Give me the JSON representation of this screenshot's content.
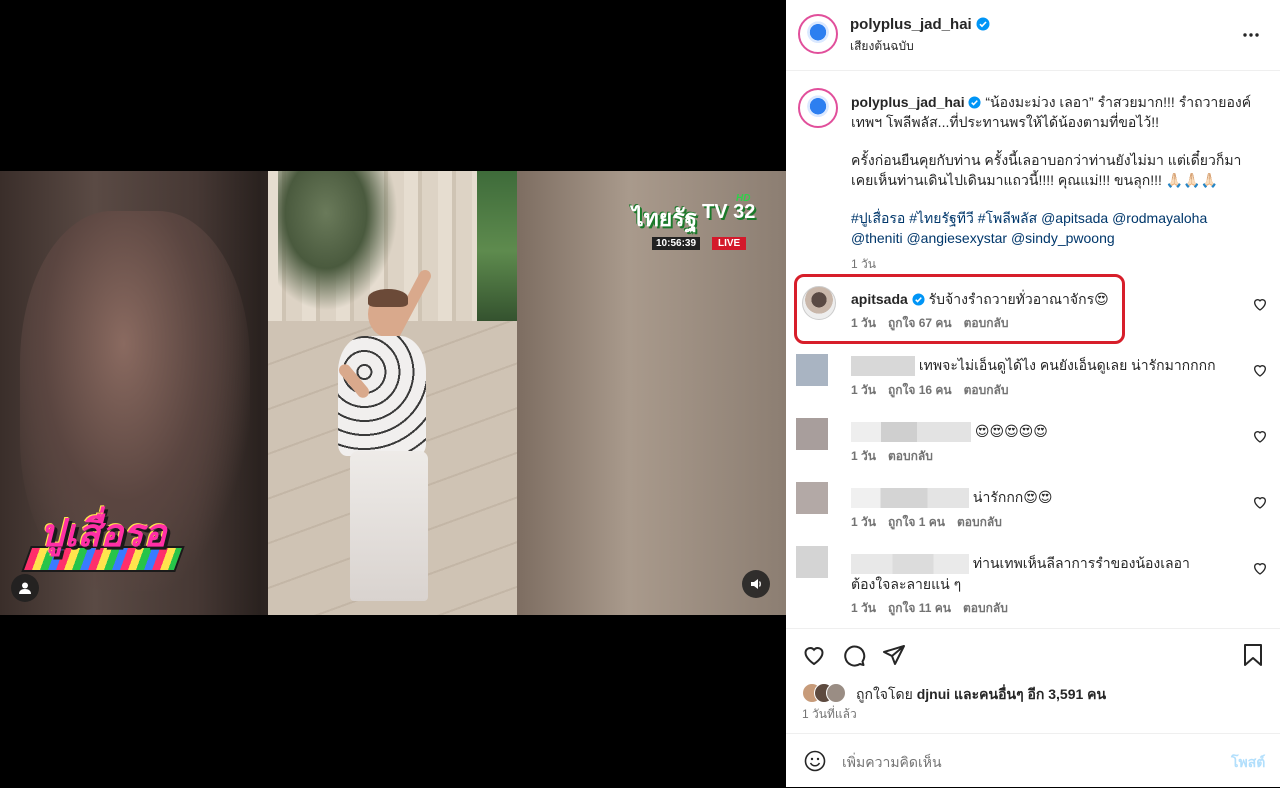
{
  "video": {
    "channel_name": "ไทยรัฐ",
    "channel_tv": "TV",
    "channel_number": "32",
    "channel_hd": "HD",
    "timestamp": "10:56:39",
    "live_label": "LIVE",
    "show_logo_text": "ปูเสื่อรอ",
    "user_icon": "user-icon",
    "sound_icon": "speaker-icon"
  },
  "header": {
    "username": "polyplus_jad_hai",
    "subtitle": "เสียงต้นฉบับ",
    "more_icon": "more-horizontal-icon"
  },
  "caption": {
    "username": "polyplus_jad_hai",
    "text1": "“น้องมะม่วง เลอา” รำสวยมาก!!! รำถวายองค์เทพฯ โพลีพลัส...ที่ประทานพรให้ได้น้องตามที่ขอไว้!!",
    "text2": "ครั้งก่อนยืนคุยกับท่าน ครั้งนี้เลอาบอกว่าท่านยังไม่มา แต่เดี๋ยวก็มา เคยเห็นท่านเดินไปเดินมาแถวนี้!!!! คุณแม่!!! ขนลุก!!! 🙏🏻🙏🏻🙏🏻",
    "hashtags": "#ปูเสื่อรอ #ไทยรัฐทีวี #โพลีพลัส @apitsada @rodmayaloha @theniti @angiesexystar @sindy_pwoong",
    "time": "1 วัน"
  },
  "comments": [
    {
      "username": "apitsada",
      "text": "รับจ้างรำถวายทั่วอาณาจักร😍",
      "time": "1 วัน",
      "likes": "ถูกใจ 67 คน",
      "reply": "ตอบกลับ"
    },
    {
      "text": "เทพจะไม่เอ็นดูได้ไง คนยังเอ็นดูเลย น่ารักมากกกก",
      "time": "1 วัน",
      "likes": "ถูกใจ 16 คน"
    },
    {
      "text": "😍😍😍😍😍",
      "time": "1 วัน",
      "reply": "ตอบกลับ"
    },
    {
      "text": "น่ารักกก😍😍",
      "time": "1 วัน",
      "likes": "ถูกใจ 1 คน",
      "reply": "ตอบกลับ"
    },
    {
      "text": "ท่านเทพเห็นลีลาการรำของน้องเลอา ต้องใจละลายแน่ ๆ",
      "time": "1 วัน",
      "likes": "ถูกใจ 11 คน",
      "reply": "ตอบกลับ"
    }
  ],
  "actions": {
    "like_icon": "heart-icon",
    "comment_icon": "comment-icon",
    "share_icon": "send-icon",
    "save_icon": "bookmark-icon",
    "likes_prefix": "ถูกใจโดย",
    "likes_user": "djnui",
    "likes_suffix": "และคนอื่นๆ อีก 3,591 คน",
    "posted": "1 วันที่แล้ว"
  },
  "add_comment": {
    "placeholder": "เพิ่มความคิดเห็น",
    "post_label": "โพสต์",
    "emoji_icon": "emoji-icon"
  },
  "colors": {
    "highlight_box": "#d71e2a",
    "link": "#00376b",
    "verified": "#0095f6"
  }
}
